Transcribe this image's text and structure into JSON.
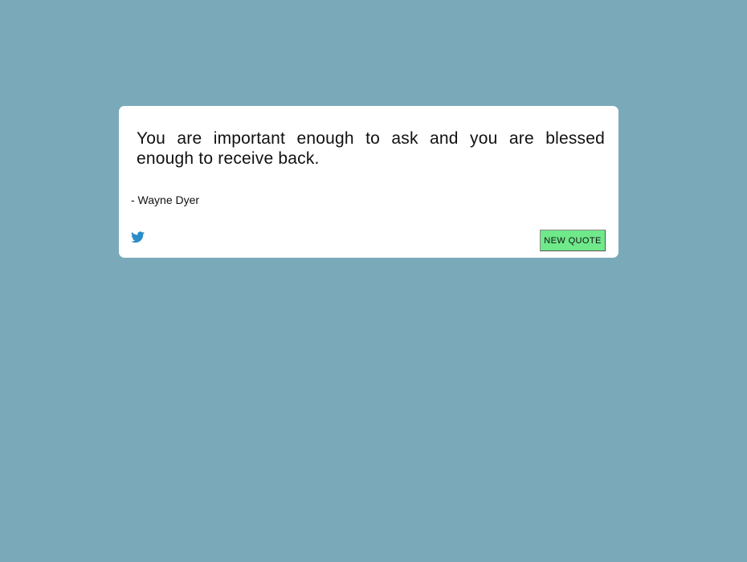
{
  "colors": {
    "background": "#7aaaba",
    "card": "#ffffff",
    "button": "#6fe98a",
    "twitter": "#2b8dc7"
  },
  "quote": {
    "text": "You are important enough to ask and you are blessed enough to receive back.",
    "author": "- Wayne Dyer"
  },
  "actions": {
    "tweet_icon": "twitter-bird-icon",
    "new_quote_label": "NEW QUOTE"
  }
}
